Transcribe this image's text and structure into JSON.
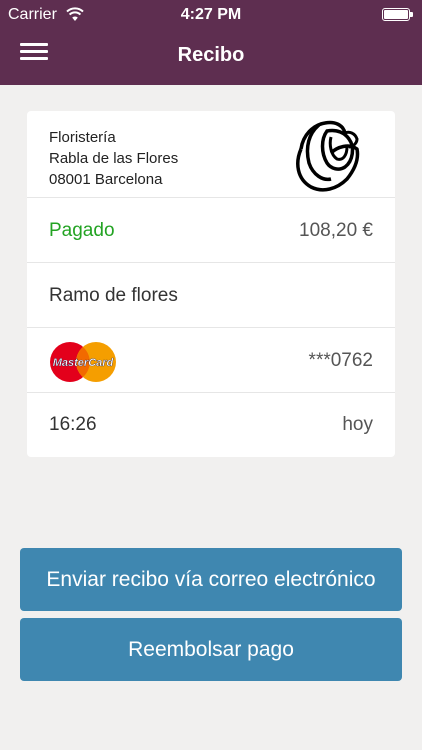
{
  "status_bar": {
    "carrier": "Carrier",
    "time": "4:27 PM",
    "icons": [
      "wifi-icon",
      "battery-icon"
    ]
  },
  "header": {
    "title": "Recibo",
    "menu_icon": "hamburger-menu-icon",
    "background_color": "#5e2e50"
  },
  "receipt": {
    "merchant": {
      "line1": "Floristería",
      "line2": "Rabla de las Flores",
      "line3": "08001 Barcelona",
      "logo_icon": "rose-logo-icon"
    },
    "payment": {
      "status": "Pagado",
      "amount": "108,20 €",
      "status_color": "#23a323"
    },
    "description": "Ramo de flores",
    "card": {
      "brand_icon": "mastercard-icon",
      "brand_text": "MasterCard",
      "number": "***0762"
    },
    "time": "16:26",
    "date": "hoy"
  },
  "actions": {
    "email_label": "Enviar recibo vía correo electrónico",
    "refund_label": "Reembolsar pago",
    "button_color": "#3f87b0"
  }
}
